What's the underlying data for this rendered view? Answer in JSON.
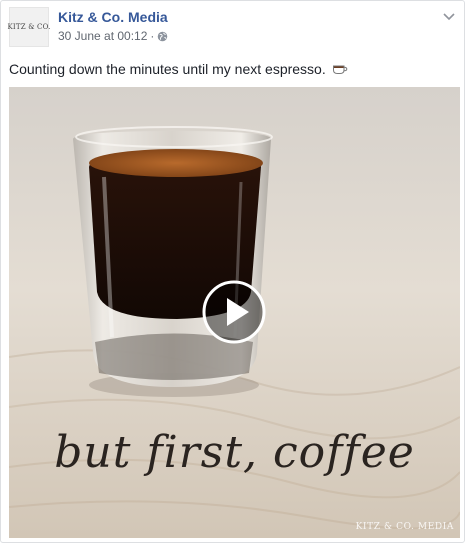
{
  "post": {
    "page_name": "Kitz & Co. Media",
    "timestamp": "30 June at 00:12",
    "separator": "·",
    "privacy_icon": "globe-icon",
    "menu_icon": "chevron-down-icon",
    "avatar_text": "KITZ & CO.",
    "text": "Counting down the minutes until my next espresso.",
    "emoji": "coffee-cup-icon"
  },
  "video": {
    "caption": "but first, coffee",
    "watermark": "KITZ & CO. MEDIA",
    "play_icon": "play-icon"
  },
  "colors": {
    "link_blue": "#365899",
    "meta_gray": "#616770",
    "text": "#1d2129"
  }
}
